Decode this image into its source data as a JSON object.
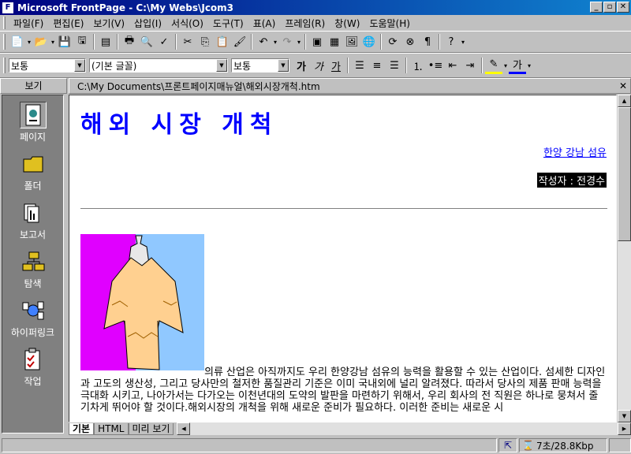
{
  "window": {
    "title": "Microsoft FrontPage - C:\\My Webs\\Jcom3"
  },
  "menu": [
    "파일(F)",
    "편집(E)",
    "보기(V)",
    "삽입(I)",
    "서식(O)",
    "도구(T)",
    "표(A)",
    "프레임(R)",
    "창(W)",
    "도움말(H)"
  ],
  "format_toolbar": {
    "style": "보통",
    "font": "(기본 글꼴)",
    "size": "보통",
    "bold": "가",
    "italic": "가",
    "underline": "가",
    "font_color_glyph": "가"
  },
  "views": {
    "header": "보기",
    "items": [
      {
        "label": "페이지",
        "icon": "page-view-icon",
        "selected": true
      },
      {
        "label": "폴더",
        "icon": "folder-view-icon"
      },
      {
        "label": "보고서",
        "icon": "reports-view-icon"
      },
      {
        "label": "탐색",
        "icon": "navigation-view-icon"
      },
      {
        "label": "하이퍼링크",
        "icon": "hyperlinks-view-icon"
      },
      {
        "label": "작업",
        "icon": "tasks-view-icon"
      }
    ]
  },
  "document": {
    "path": "C:\\My Documents\\프론트페이지매뉴얼\\해외시장개척.htm",
    "heading": "해외 시장 개척",
    "company_link": "한양 강남 섬유",
    "author": "작성자 : 전경수",
    "body": "의류 산업은 아직까지도 우리 한양강남 섬유의 능력을 활용할 수 있는 산업이다. 섬세한 디자인과 고도의 생산성, 그리고 당사만의 철저한 품질관리 기준은 이미 국내외에 널리 알려졌다. 따라서 당사의 제품 판매 능력을 극대화 시키고, 나아가서는 다가오는 이천년대의 도약의 발판을 마련하기 위해서, 우리 회사의 전 직원은 하나로 뭉쳐서 줄기차게 뛰어야 할 것이다.해외시장의 개척을 위해 새로운 준비가 필요하다. 이러한 준비는 새로운 시"
  },
  "view_tabs": [
    "기본",
    "HTML",
    "미리 보기"
  ],
  "status": {
    "download_time": "7초/28.8Kbp"
  },
  "colors": {
    "heading": "#0000ff",
    "titlebar": "#000080",
    "views_bg": "#808080"
  }
}
